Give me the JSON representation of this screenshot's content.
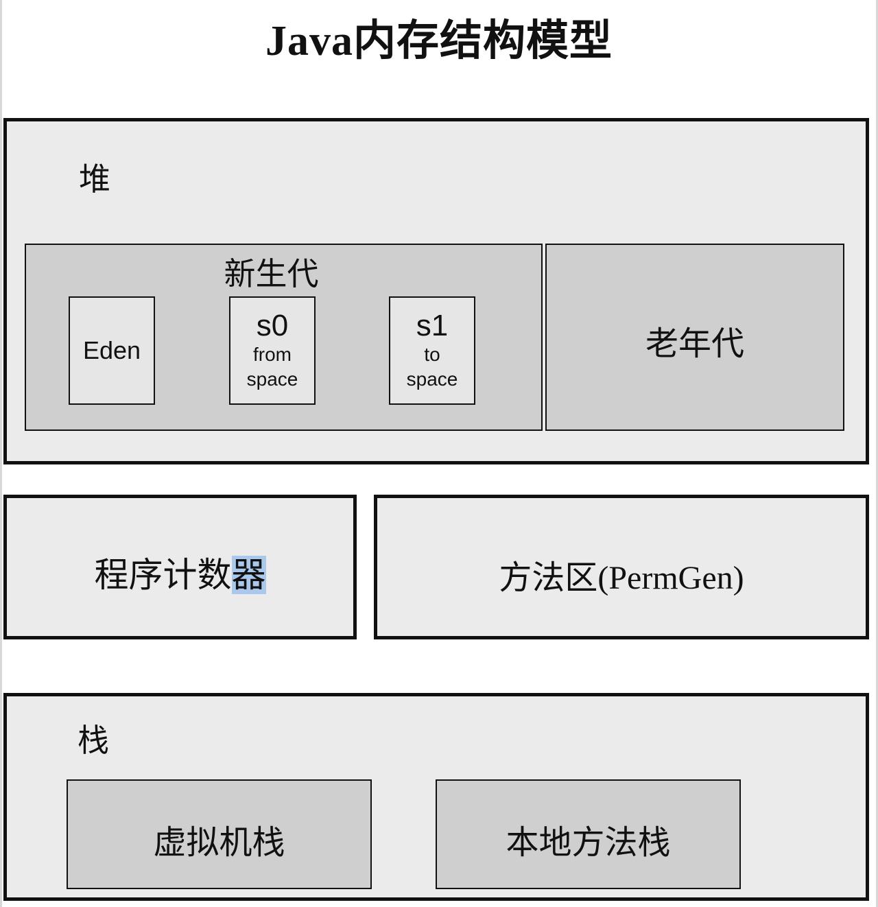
{
  "title": "Java内存结构模型",
  "heap": {
    "label": "堆",
    "young_gen": {
      "label": "新生代",
      "eden": "Eden",
      "s0": {
        "name": "s0",
        "line1": "from",
        "line2": "space"
      },
      "s1": {
        "name": "s1",
        "line1": "to",
        "line2": "space"
      }
    },
    "old_gen": {
      "label": "老年代"
    }
  },
  "program_counter": {
    "label_plain": "程序计数",
    "label_highlighted": "器"
  },
  "method_area": {
    "label": "方法区(PermGen)"
  },
  "stack": {
    "label": "栈",
    "vm_stack": "虚拟机栈",
    "native_stack": "本地方法栈"
  },
  "colors": {
    "outer_box_fill": "#ebebeb",
    "inner_box_fill": "#cfcfcf",
    "border": "#111111",
    "selection_highlight": "#a9c8ec"
  }
}
